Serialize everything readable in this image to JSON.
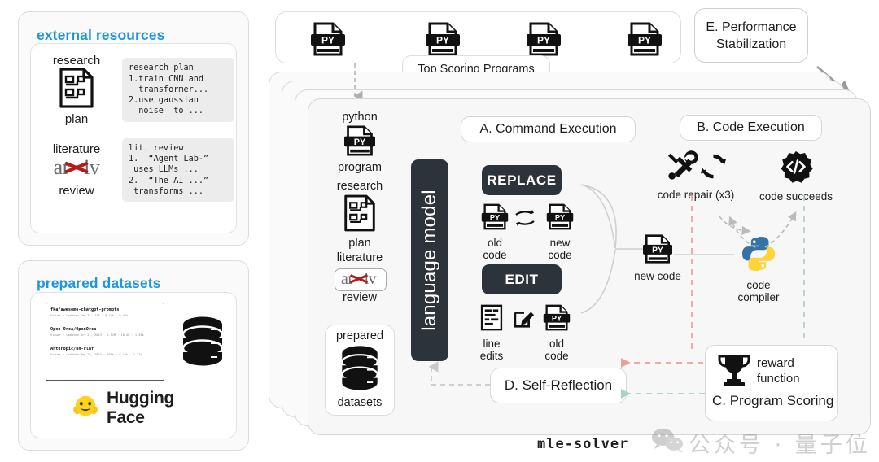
{
  "external_resources": {
    "title": "external resources",
    "items": [
      {
        "label_top": "research",
        "label_bottom": "plan",
        "icon": "research-plan-document-icon",
        "text": "research plan\n1.train CNN and\n  transformer...\n2.use gaussian\n  noise  to ..."
      },
      {
        "label_top": "literature",
        "label_bottom": "review",
        "icon": "arxiv-logo-icon",
        "arxiv_left": "ar",
        "arxiv_right": "iv",
        "text": "lit. review\n1.  “Agent Lab-”\n uses LLMs ...\n2.  “The AI ...”\n transforms ..."
      }
    ]
  },
  "prepared_datasets": {
    "title": "prepared datasets",
    "brand": "Hugging Face",
    "brand_icon": "hugging-face-emoji-icon",
    "database_icon": "database-stack-icon",
    "list": [
      {
        "name": "fka/awesome-chatgpt-prompts",
        "meta": "Viewer · Updated Sep 3 · 173 · 9.24k · 9.41k"
      },
      {
        "name": "Open-Orca/OpenOrca",
        "meta": "Viewer · Updated Oct 21, 2023 · 2.91M · 10.4k · 1.34k"
      },
      {
        "name": "Anthropic/hh-rlhf",
        "meta": "Viewer · Updated May 26, 2023 · 169k · 8.16k · 1.21k"
      }
    ]
  },
  "top_programs": {
    "label": "Top Scoring Programs",
    "icons": [
      "py-file-icon",
      "py-file-icon",
      "py-file-icon",
      "py-file-icon"
    ],
    "icon_text": "PY"
  },
  "performance_stabilization": {
    "line1": "E. Performance",
    "line2": "Stabilization",
    "arrow": "diagonal-arrow-icon"
  },
  "solver": {
    "name": "mle-solver",
    "language_model": "language model",
    "inputs": [
      {
        "top": "python",
        "bottom": "program",
        "icon": "py-file-icon",
        "icon_text": "PY"
      },
      {
        "top": "research",
        "bottom": "plan",
        "icon": "research-plan-document-icon"
      },
      {
        "top": "literature",
        "bottom": "review",
        "icon": "arxiv-logo-icon",
        "arxiv_left": "ar",
        "arxiv_right": "iv"
      },
      {
        "top": "prepared",
        "bottom": "datasets",
        "icon": "database-stack-icon"
      }
    ]
  },
  "command_execution": {
    "title": "A. Command Execution",
    "commands": [
      {
        "button": "REPLACE",
        "items": [
          {
            "label": "old code",
            "icon": "py-file-icon",
            "icon_text": "PY"
          },
          {
            "label": "",
            "icon": "swap-arrows-icon"
          },
          {
            "label": "new code",
            "icon": "py-file-icon",
            "icon_text": "PY"
          }
        ]
      },
      {
        "button": "EDIT",
        "items": [
          {
            "label": "line edits",
            "icon": "line-edits-document-icon"
          },
          {
            "label": "",
            "icon": "pencil-edit-icon"
          },
          {
            "label": "old code",
            "icon": "py-file-icon",
            "icon_text": "PY"
          }
        ]
      }
    ],
    "output": {
      "label": "new code",
      "icon": "py-file-icon",
      "icon_text": "PY"
    }
  },
  "code_execution": {
    "title": "B. Code Execution",
    "nodes": [
      {
        "label": "code repair (x3)",
        "icon": "wrench-screwdriver-refresh-icon"
      },
      {
        "label": "code succeeds",
        "icon": "code-gear-icon"
      },
      {
        "label": "code\ncompiler",
        "icon": "python-logo-icon",
        "label_line1": "code",
        "label_line2": "compiler"
      }
    ]
  },
  "self_reflection": {
    "title": "D. Self-Reflection"
  },
  "program_scoring": {
    "title": "C. Program Scoring",
    "reward_line1": "reward",
    "reward_line2": "function",
    "icon": "trophy-icon"
  },
  "watermark": {
    "text": "公众号 · 量子位",
    "icon": "wechat-icon"
  },
  "colors": {
    "accent_blue": "#2196d9",
    "dark": "#2c333a",
    "arxiv_red": "#b31b1b",
    "repair_dash": "#e8a09a",
    "success_dash": "#a8d5c2"
  }
}
